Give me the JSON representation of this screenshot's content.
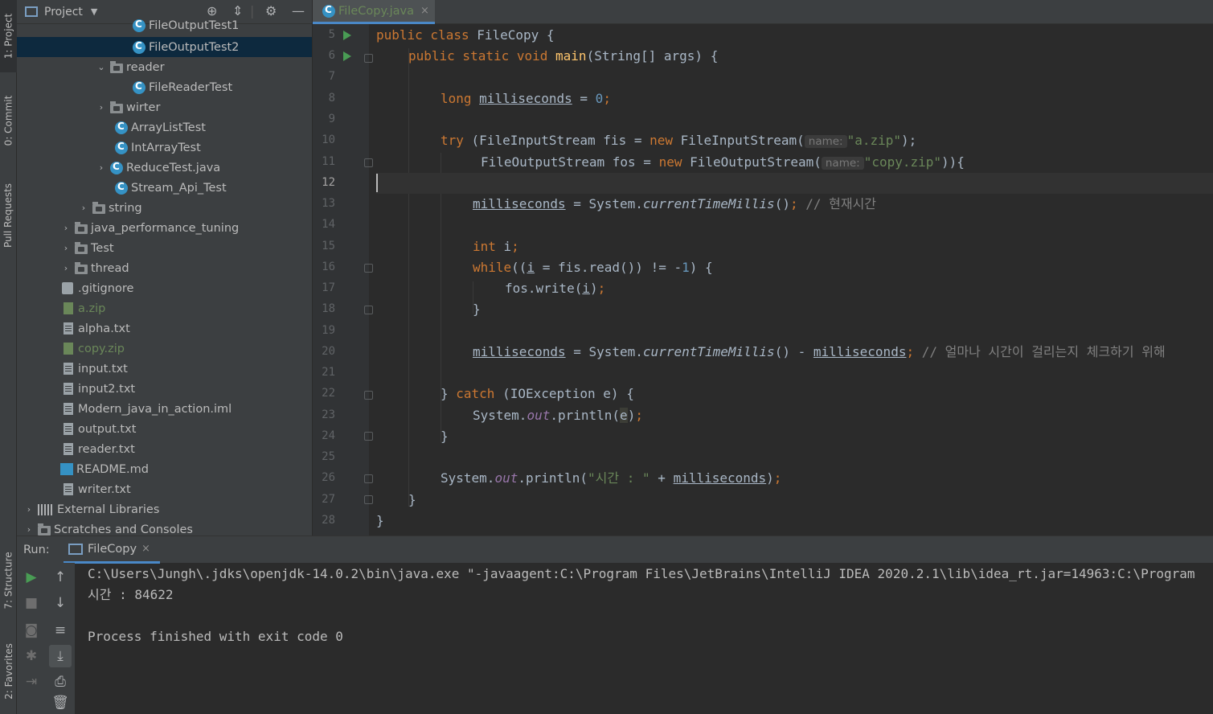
{
  "left_strip": {
    "project_tab": "1: Project",
    "commit_tab": "0: Commit",
    "pull_requests_tab": "Pull Requests",
    "structure_tab": "7: Structure",
    "favorites_tab": "2: Favorites"
  },
  "project_panel": {
    "title": "Project",
    "tree": [
      {
        "label": "FileOutputTest1",
        "icon": "class-icon"
      },
      {
        "label": "FileOutputTest2",
        "icon": "class-icon",
        "selected": true
      },
      {
        "label": "reader",
        "icon": "folder-icon",
        "expanded": true
      },
      {
        "label": "FileReaderTest",
        "icon": "class-icon"
      },
      {
        "label": "wirter",
        "icon": "folder-icon",
        "expanded": false
      },
      {
        "label": "ArrayListTest",
        "icon": "class-icon"
      },
      {
        "label": "IntArrayTest",
        "icon": "class-icon"
      },
      {
        "label": "ReduceTest.java",
        "icon": "class-icon",
        "expanded": false
      },
      {
        "label": "Stream_Api_Test",
        "icon": "class-icon"
      },
      {
        "label": "string",
        "icon": "folder-icon",
        "expanded": false
      },
      {
        "label": "java_performance_tuning",
        "icon": "folder-icon",
        "expanded": false
      },
      {
        "label": "Test",
        "icon": "folder-icon",
        "expanded": false
      },
      {
        "label": "thread",
        "icon": "folder-icon",
        "expanded": false
      },
      {
        "label": ".gitignore",
        "icon": "gitignore-file-icon"
      },
      {
        "label": "a.zip",
        "icon": "zip-file-icon"
      },
      {
        "label": "alpha.txt",
        "icon": "text-file-icon"
      },
      {
        "label": "copy.zip",
        "icon": "zip-file-icon"
      },
      {
        "label": "input.txt",
        "icon": "text-file-icon"
      },
      {
        "label": "input2.txt",
        "icon": "text-file-icon"
      },
      {
        "label": "Modern_java_in_action.iml",
        "icon": "iml-file-icon"
      },
      {
        "label": "output.txt",
        "icon": "text-file-icon"
      },
      {
        "label": "reader.txt",
        "icon": "text-file-icon"
      },
      {
        "label": "README.md",
        "icon": "markdown-file-icon"
      },
      {
        "label": "writer.txt",
        "icon": "text-file-icon"
      },
      {
        "label": "External Libraries",
        "icon": "library-icon",
        "expanded": false
      },
      {
        "label": "Scratches and Consoles",
        "icon": "scratches-icon",
        "expanded": false
      }
    ]
  },
  "editor": {
    "tab_label": "FileCopy.java",
    "tab_close": "×",
    "line_numbers": [
      "5",
      "6",
      "7",
      "8",
      "9",
      "10",
      "11",
      "12",
      "13",
      "14",
      "15",
      "16",
      "17",
      "18",
      "19",
      "20",
      "21",
      "22",
      "23",
      "24",
      "25",
      "26",
      "27",
      "28"
    ],
    "current_line": "12",
    "hint_name": "name:",
    "code": {
      "l5a": "public class",
      "l5b": " FileCopy {",
      "l6a": "public static void",
      "l6b": "main",
      "l6c": "(String[] args) {",
      "l8a": "long",
      "l8b": "milliseconds",
      "l8c": " = ",
      "l8d": "0",
      "l8e": ";",
      "l10a": "try",
      "l10b": " (FileInputStream fis = ",
      "l10c": "new",
      "l10d": " FileInputStream(",
      "l10e": "\"a.zip\"",
      "l10f": ");",
      "l11a": "FileOutputStream fos = ",
      "l11b": "new",
      "l11c": " FileOutputStream(",
      "l11d": "\"copy.zip\"",
      "l11e": ")){",
      "l13a": "milliseconds",
      "l13b": " = System.",
      "l13c": "currentTimeMillis",
      "l13d": "()",
      "l13e": ";",
      "l13f": " // 현재시간",
      "l15a": "int",
      "l15b": " i",
      "l15c": ";",
      "l16a": "while",
      "l16b": "((",
      "l16c": "i",
      "l16d": " = fis.read()) != -",
      "l16e": "1",
      "l16f": ") {",
      "l17a": "fos.write(",
      "l17b": "i",
      "l17c": ")",
      "l17d": ";",
      "l18a": "}",
      "l20a": "milliseconds",
      "l20b": " = System.",
      "l20c": "currentTimeMillis",
      "l20d": "() - ",
      "l20e": "milliseconds",
      "l20f": ";",
      "l20g": " // 얼마나 시간이 걸리는지 체크하기 위해",
      "l22a": "} ",
      "l22b": "catch",
      "l22c": " (IOException e) {",
      "l23a": "System.",
      "l23b": "out",
      "l23c": ".println(",
      "l23d": "e",
      "l23e": ")",
      "l23f": ";",
      "l24a": "}",
      "l26a": "System.",
      "l26b": "out",
      "l26c": ".println(",
      "l26d": "\"시간 : \"",
      "l26e": " + ",
      "l26f": "milliseconds",
      "l26g": ")",
      "l26h": ";",
      "l27a": "}",
      "l28a": "}"
    }
  },
  "run_panel": {
    "label": "Run:",
    "tab_label": "FileCopy",
    "tab_close": "×",
    "output": [
      "C:\\Users\\Jungh\\.jdks\\openjdk-14.0.2\\bin\\java.exe \"-javaagent:C:\\Program Files\\JetBrains\\IntelliJ IDEA 2020.2.1\\lib\\idea_rt.jar=14963:C:\\Program",
      "시간 : 84622",
      "",
      "Process finished with exit code 0"
    ]
  },
  "colors": {
    "keyword": "#cc7832",
    "string": "#6a8759",
    "number": "#6897bb",
    "method": "#ffc66d",
    "field": "#9876aa",
    "selection": "#0d293e",
    "accent": "#4a88c7"
  }
}
